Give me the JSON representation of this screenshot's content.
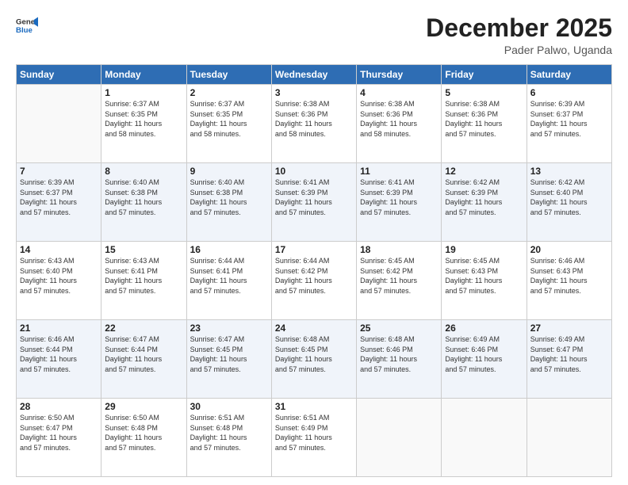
{
  "header": {
    "logo_general": "General",
    "logo_blue": "Blue",
    "month_title": "December 2025",
    "subtitle": "Pader Palwo, Uganda"
  },
  "days_of_week": [
    "Sunday",
    "Monday",
    "Tuesday",
    "Wednesday",
    "Thursday",
    "Friday",
    "Saturday"
  ],
  "weeks": [
    [
      {
        "day": "",
        "sunrise": "",
        "sunset": "",
        "daylight": ""
      },
      {
        "day": "1",
        "sunrise": "Sunrise: 6:37 AM",
        "sunset": "Sunset: 6:35 PM",
        "daylight": "Daylight: 11 hours and 58 minutes."
      },
      {
        "day": "2",
        "sunrise": "Sunrise: 6:37 AM",
        "sunset": "Sunset: 6:35 PM",
        "daylight": "Daylight: 11 hours and 58 minutes."
      },
      {
        "day": "3",
        "sunrise": "Sunrise: 6:38 AM",
        "sunset": "Sunset: 6:36 PM",
        "daylight": "Daylight: 11 hours and 58 minutes."
      },
      {
        "day": "4",
        "sunrise": "Sunrise: 6:38 AM",
        "sunset": "Sunset: 6:36 PM",
        "daylight": "Daylight: 11 hours and 58 minutes."
      },
      {
        "day": "5",
        "sunrise": "Sunrise: 6:38 AM",
        "sunset": "Sunset: 6:36 PM",
        "daylight": "Daylight: 11 hours and 57 minutes."
      },
      {
        "day": "6",
        "sunrise": "Sunrise: 6:39 AM",
        "sunset": "Sunset: 6:37 PM",
        "daylight": "Daylight: 11 hours and 57 minutes."
      }
    ],
    [
      {
        "day": "7",
        "sunrise": "Sunrise: 6:39 AM",
        "sunset": "Sunset: 6:37 PM",
        "daylight": "Daylight: 11 hours and 57 minutes."
      },
      {
        "day": "8",
        "sunrise": "Sunrise: 6:40 AM",
        "sunset": "Sunset: 6:38 PM",
        "daylight": "Daylight: 11 hours and 57 minutes."
      },
      {
        "day": "9",
        "sunrise": "Sunrise: 6:40 AM",
        "sunset": "Sunset: 6:38 PM",
        "daylight": "Daylight: 11 hours and 57 minutes."
      },
      {
        "day": "10",
        "sunrise": "Sunrise: 6:41 AM",
        "sunset": "Sunset: 6:39 PM",
        "daylight": "Daylight: 11 hours and 57 minutes."
      },
      {
        "day": "11",
        "sunrise": "Sunrise: 6:41 AM",
        "sunset": "Sunset: 6:39 PM",
        "daylight": "Daylight: 11 hours and 57 minutes."
      },
      {
        "day": "12",
        "sunrise": "Sunrise: 6:42 AM",
        "sunset": "Sunset: 6:39 PM",
        "daylight": "Daylight: 11 hours and 57 minutes."
      },
      {
        "day": "13",
        "sunrise": "Sunrise: 6:42 AM",
        "sunset": "Sunset: 6:40 PM",
        "daylight": "Daylight: 11 hours and 57 minutes."
      }
    ],
    [
      {
        "day": "14",
        "sunrise": "Sunrise: 6:43 AM",
        "sunset": "Sunset: 6:40 PM",
        "daylight": "Daylight: 11 hours and 57 minutes."
      },
      {
        "day": "15",
        "sunrise": "Sunrise: 6:43 AM",
        "sunset": "Sunset: 6:41 PM",
        "daylight": "Daylight: 11 hours and 57 minutes."
      },
      {
        "day": "16",
        "sunrise": "Sunrise: 6:44 AM",
        "sunset": "Sunset: 6:41 PM",
        "daylight": "Daylight: 11 hours and 57 minutes."
      },
      {
        "day": "17",
        "sunrise": "Sunrise: 6:44 AM",
        "sunset": "Sunset: 6:42 PM",
        "daylight": "Daylight: 11 hours and 57 minutes."
      },
      {
        "day": "18",
        "sunrise": "Sunrise: 6:45 AM",
        "sunset": "Sunset: 6:42 PM",
        "daylight": "Daylight: 11 hours and 57 minutes."
      },
      {
        "day": "19",
        "sunrise": "Sunrise: 6:45 AM",
        "sunset": "Sunset: 6:43 PM",
        "daylight": "Daylight: 11 hours and 57 minutes."
      },
      {
        "day": "20",
        "sunrise": "Sunrise: 6:46 AM",
        "sunset": "Sunset: 6:43 PM",
        "daylight": "Daylight: 11 hours and 57 minutes."
      }
    ],
    [
      {
        "day": "21",
        "sunrise": "Sunrise: 6:46 AM",
        "sunset": "Sunset: 6:44 PM",
        "daylight": "Daylight: 11 hours and 57 minutes."
      },
      {
        "day": "22",
        "sunrise": "Sunrise: 6:47 AM",
        "sunset": "Sunset: 6:44 PM",
        "daylight": "Daylight: 11 hours and 57 minutes."
      },
      {
        "day": "23",
        "sunrise": "Sunrise: 6:47 AM",
        "sunset": "Sunset: 6:45 PM",
        "daylight": "Daylight: 11 hours and 57 minutes."
      },
      {
        "day": "24",
        "sunrise": "Sunrise: 6:48 AM",
        "sunset": "Sunset: 6:45 PM",
        "daylight": "Daylight: 11 hours and 57 minutes."
      },
      {
        "day": "25",
        "sunrise": "Sunrise: 6:48 AM",
        "sunset": "Sunset: 6:46 PM",
        "daylight": "Daylight: 11 hours and 57 minutes."
      },
      {
        "day": "26",
        "sunrise": "Sunrise: 6:49 AM",
        "sunset": "Sunset: 6:46 PM",
        "daylight": "Daylight: 11 hours and 57 minutes."
      },
      {
        "day": "27",
        "sunrise": "Sunrise: 6:49 AM",
        "sunset": "Sunset: 6:47 PM",
        "daylight": "Daylight: 11 hours and 57 minutes."
      }
    ],
    [
      {
        "day": "28",
        "sunrise": "Sunrise: 6:50 AM",
        "sunset": "Sunset: 6:47 PM",
        "daylight": "Daylight: 11 hours and 57 minutes."
      },
      {
        "day": "29",
        "sunrise": "Sunrise: 6:50 AM",
        "sunset": "Sunset: 6:48 PM",
        "daylight": "Daylight: 11 hours and 57 minutes."
      },
      {
        "day": "30",
        "sunrise": "Sunrise: 6:51 AM",
        "sunset": "Sunset: 6:48 PM",
        "daylight": "Daylight: 11 hours and 57 minutes."
      },
      {
        "day": "31",
        "sunrise": "Sunrise: 6:51 AM",
        "sunset": "Sunset: 6:49 PM",
        "daylight": "Daylight: 11 hours and 57 minutes."
      },
      {
        "day": "",
        "sunrise": "",
        "sunset": "",
        "daylight": ""
      },
      {
        "day": "",
        "sunrise": "",
        "sunset": "",
        "daylight": ""
      },
      {
        "day": "",
        "sunrise": "",
        "sunset": "",
        "daylight": ""
      }
    ]
  ]
}
